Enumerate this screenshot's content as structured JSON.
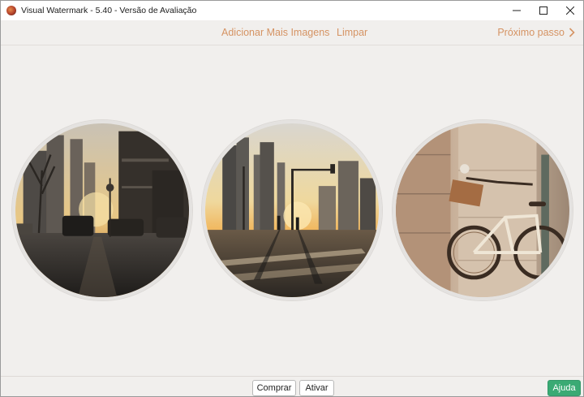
{
  "window": {
    "title": "Visual Watermark - 5.40 - Versão de Avaliação",
    "controls": [
      "minimize-icon",
      "maximize-icon",
      "close-icon"
    ]
  },
  "toolbar": {
    "add_images": "Adicionar Mais Imagens",
    "clear": "Limpar",
    "next_step": "Próximo passo",
    "link_color": "#d59363"
  },
  "images": [
    {
      "subject": "city street with cars at sunset"
    },
    {
      "subject": "empty crosswalk with skyscrapers at sunset"
    },
    {
      "subject": "white bicycle leaning against stone column"
    }
  ],
  "footer": {
    "buy": "Comprar",
    "activate": "Ativar",
    "help": "Ajuda",
    "help_color": "#3aaa74"
  }
}
